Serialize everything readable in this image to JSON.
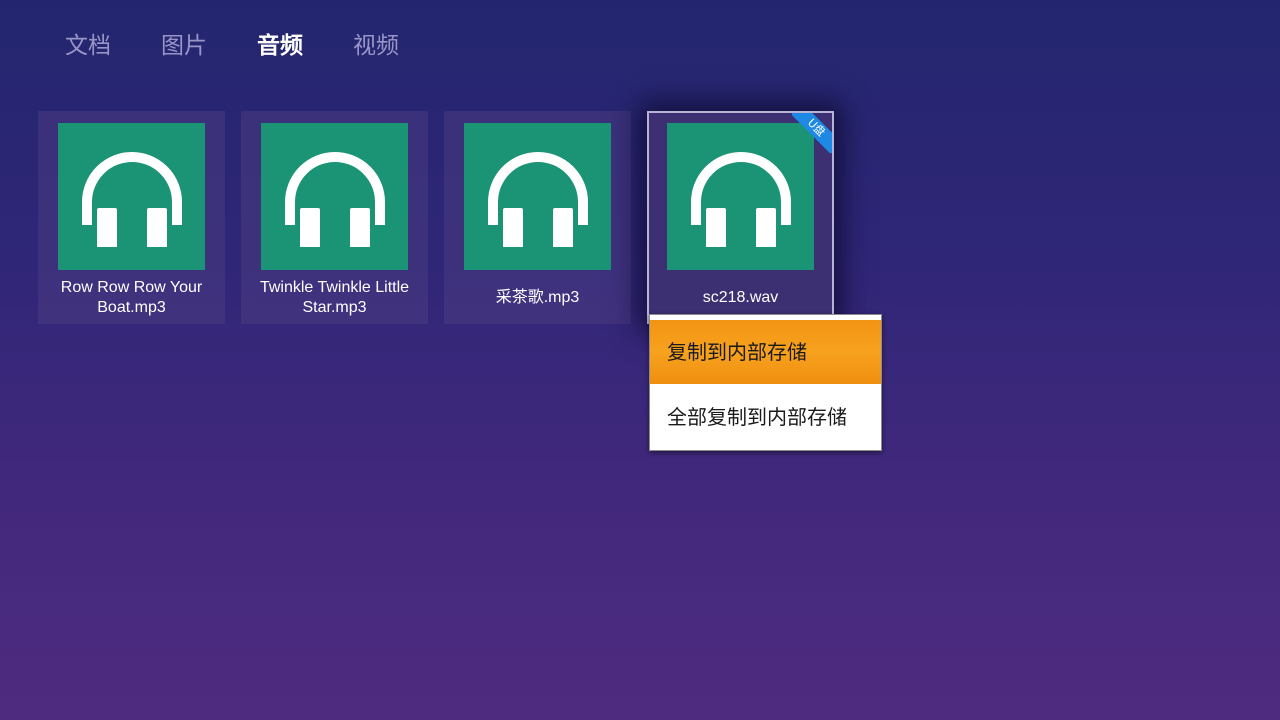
{
  "tabs": [
    {
      "label": "文档",
      "active": false
    },
    {
      "label": "图片",
      "active": false
    },
    {
      "label": "音频",
      "active": true
    },
    {
      "label": "视频",
      "active": false
    }
  ],
  "files": [
    {
      "name": "Row Row Row Your Boat.mp3",
      "icon": "headphones-icon",
      "focused": false
    },
    {
      "name": "Twinkle Twinkle Little Star.mp3",
      "icon": "headphones-icon",
      "focused": false
    },
    {
      "name": "采茶歌.mp3",
      "icon": "headphones-icon",
      "focused": false
    },
    {
      "name": "sc218.wav",
      "icon": "headphones-icon",
      "focused": true,
      "badge": "U盘"
    }
  ],
  "context_menu": {
    "items": [
      {
        "label": "复制到内部存储",
        "highlighted": true
      },
      {
        "label": "全部复制到内部存储",
        "highlighted": false
      }
    ]
  },
  "colors": {
    "thumbnail_bg": "#1b9476",
    "highlight": "#f7a21e",
    "badge": "#1e88e5"
  }
}
